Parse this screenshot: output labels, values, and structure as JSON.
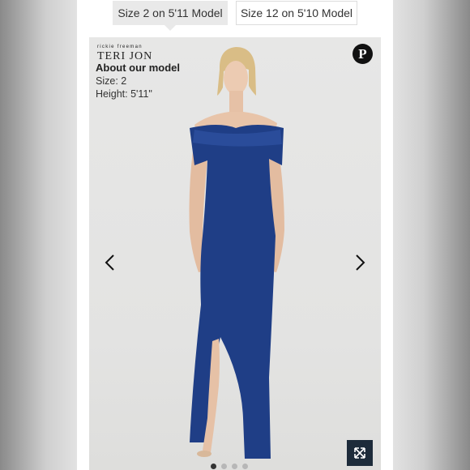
{
  "tabs": [
    {
      "label": "Size 2 on 5'11 Model",
      "active": true
    },
    {
      "label": "Size 12 on 5'10 Model",
      "active": false
    }
  ],
  "brand": {
    "small": "rickie freeman",
    "main": "TERI JON"
  },
  "model": {
    "title": "About our model",
    "size_line": "Size: 2",
    "height_line": "Height: 5'11\""
  },
  "gallery": {
    "slide_count": 4,
    "active_slide": 1
  },
  "icons": {
    "pinterest": "pinterest-icon",
    "prev": "chevron-left-icon",
    "next": "chevron-right-icon",
    "expand": "expand-icon"
  },
  "colors": {
    "dress": "#1f3e86",
    "expand_bg": "#1d2b3a"
  }
}
